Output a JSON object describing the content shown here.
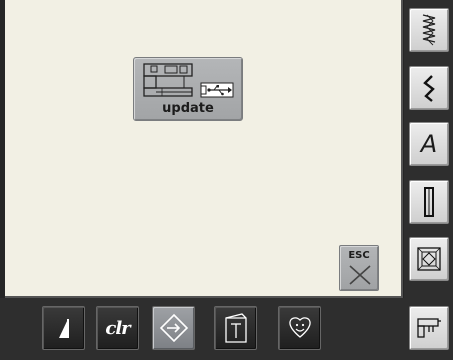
{
  "screen": {
    "update_button": {
      "label": "update",
      "icons": [
        "sewing-machine-icon",
        "usb-stick-icon"
      ]
    },
    "esc_button": {
      "label": "ESC",
      "icon": "close-x-icon"
    }
  },
  "right_sidebar": {
    "items": [
      {
        "name": "decorative-stitch-icon"
      },
      {
        "name": "practical-stitch-icon"
      },
      {
        "name": "alphabet-icon",
        "label": "A"
      },
      {
        "name": "buttonhole-icon"
      },
      {
        "name": "quilt-stitch-icon"
      },
      {
        "name": "setup-icon"
      }
    ]
  },
  "bottom_bar": {
    "items": [
      {
        "name": "presser-foot-pressure-icon"
      },
      {
        "name": "clr-button",
        "label": "clr"
      },
      {
        "name": "setup-program-icon",
        "state": "active"
      },
      {
        "name": "tutorial-icon"
      },
      {
        "name": "personal-program-icon"
      }
    ]
  },
  "colors": {
    "screen_bg": "#f2f0e4",
    "panel_bg": "#2e2e2e",
    "button_gray": "#a8aaac"
  }
}
